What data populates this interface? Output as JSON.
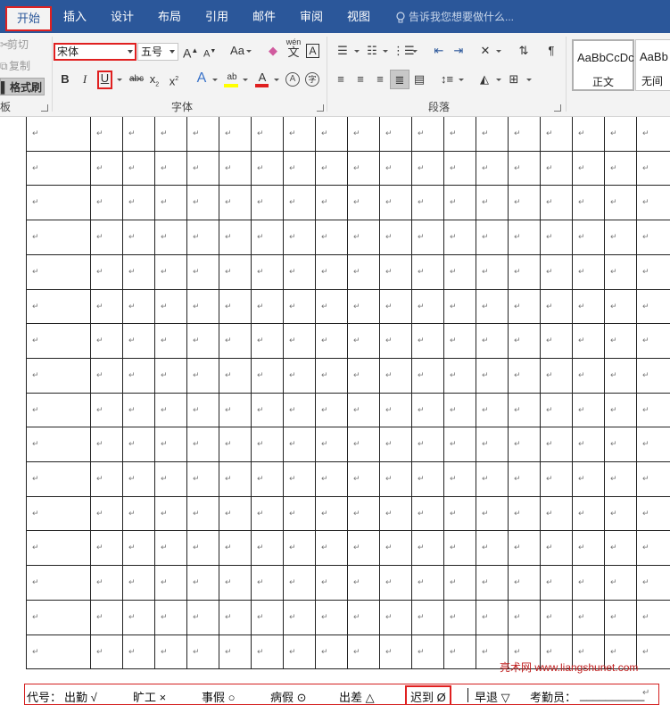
{
  "tabs": [
    {
      "label": "开始",
      "active": true
    },
    {
      "label": "插入"
    },
    {
      "label": "设计"
    },
    {
      "label": "布局"
    },
    {
      "label": "引用"
    },
    {
      "label": "邮件"
    },
    {
      "label": "审阅"
    },
    {
      "label": "视图"
    }
  ],
  "tell_me": "告诉我您想要做什么...",
  "clipboard": {
    "cut": "剪切",
    "copy": "复制",
    "format_painter": "格式刷",
    "group_label": "板"
  },
  "font": {
    "name": "宋体",
    "size": "五号",
    "change_case": "Aa",
    "wen_top": "wén",
    "wen_bottom": "文",
    "border_char": "A",
    "bold": "B",
    "italic": "I",
    "underline": "U",
    "strike": "abc",
    "sub": "x",
    "sup": "x",
    "sub_mark": "2",
    "sup_mark": "2",
    "highlight": "ab",
    "font_color": "A",
    "enclose": "字",
    "group_label": "字体",
    "grow": "A",
    "shrink": "A"
  },
  "paragraph": {
    "group_label": "段落"
  },
  "styles": [
    {
      "sample": "AaBbCcDc",
      "name": "正文"
    },
    {
      "sample": "AaBb",
      "name": "无间"
    }
  ],
  "return_mark": "↵",
  "legend": {
    "prefix": "代号：",
    "items": [
      {
        "label": "出勤",
        "symbol": "√"
      },
      {
        "label": "旷工",
        "symbol": "×"
      },
      {
        "label": "事假",
        "symbol": "○"
      },
      {
        "label": "病假",
        "symbol": "⊙"
      },
      {
        "label": "出差",
        "symbol": "△"
      },
      {
        "label": "迟到",
        "symbol": "Ø"
      },
      {
        "label": "早退",
        "symbol": "▽"
      }
    ],
    "attendant_label": "考勤员：",
    "attendant_blank": "__________",
    "end_mark": "↵"
  },
  "watermark": "亮术网 www.liangshunet.com",
  "colors": {
    "ribbon_tab_bg": "#2b579a",
    "highlight": "#e02020",
    "font_color_bar": "#e02020",
    "highlight_bar": "#ffff00"
  }
}
